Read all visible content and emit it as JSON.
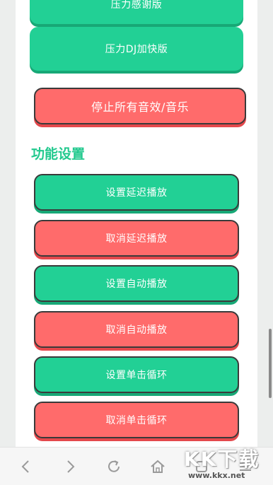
{
  "buttons": {
    "b0": "压力感谢版",
    "b1": "压力DJ加快版",
    "b2": "停止所有音效/音乐",
    "b3": "设置延迟播放",
    "b4": "取消延迟播放",
    "b5": "设置自动播放",
    "b6": "取消自动播放",
    "b7": "设置单击循环",
    "b8": "取消单击循环"
  },
  "section": {
    "title": "功能设置"
  },
  "watermark": {
    "text": "KK下载",
    "url": "www.kkx.net"
  },
  "colors": {
    "green": "#22d095",
    "red": "#ff6b6b",
    "title": "#22c98e"
  },
  "nav_icons": [
    "back-icon",
    "forward-icon",
    "refresh-icon",
    "home-icon",
    "tabs-icon",
    "menu-icon"
  ]
}
